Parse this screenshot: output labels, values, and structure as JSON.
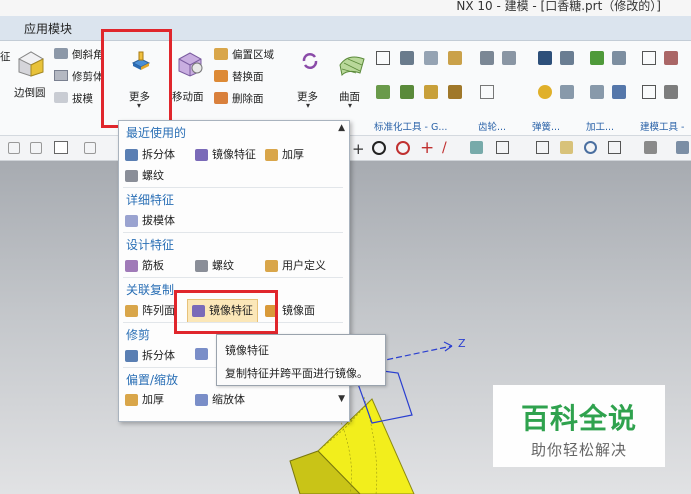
{
  "window": {
    "title": "NX 10 - 建模 - [口香糖.prt（修改的）]"
  },
  "menubar": {
    "app_tab": "应用模块"
  },
  "ribbon": {
    "left_cut_label": "征",
    "edge_blend_label": "边倒圆",
    "chamfer_label": "倒斜角",
    "trim_body_label": "修剪体",
    "draft_label": "拔模",
    "more_label": "更多",
    "move_face_label": "移动面",
    "offset_region_label": "偏置区域",
    "replace_face_label": "替换面",
    "delete_face_label": "删除面",
    "more2_label": "更多",
    "surface_label": "曲面",
    "group_standard": "标准化工具 - G...",
    "group_gear": "齿轮...",
    "group_spring": "弹簧...",
    "group_machining": "加工...",
    "group_modeling": "建模工具 -"
  },
  "menu": {
    "recent_header": "最近使用的",
    "recent_items": [
      "拆分体",
      "镜像特征",
      "加厚",
      "螺纹"
    ],
    "detail_header": "详细特征",
    "detail_items": [
      "拔模体"
    ],
    "design_header": "设计特征",
    "design_items": [
      "筋板",
      "螺纹",
      "用户定义"
    ],
    "assoc_header": "关联复制",
    "assoc_items": [
      "阵列面",
      "镜像特征",
      "镜像面"
    ],
    "trim_header": "修剪",
    "trim_items": [
      "拆分体"
    ],
    "offset_header": "偏置/缩放",
    "offset_items": [
      "加厚",
      "缩放体"
    ]
  },
  "tooltip": {
    "title": "镜像特征",
    "description": "复制特征并跨平面进行镜像。"
  },
  "viewport": {
    "axis_label": "Z"
  },
  "watermark": {
    "title": "百科全说",
    "subtitle": "助你轻松解决"
  },
  "colors": {
    "highlight_red": "#e0262c",
    "section_blue": "#2a6fb5",
    "part_yellow": "#f2ee1c"
  }
}
